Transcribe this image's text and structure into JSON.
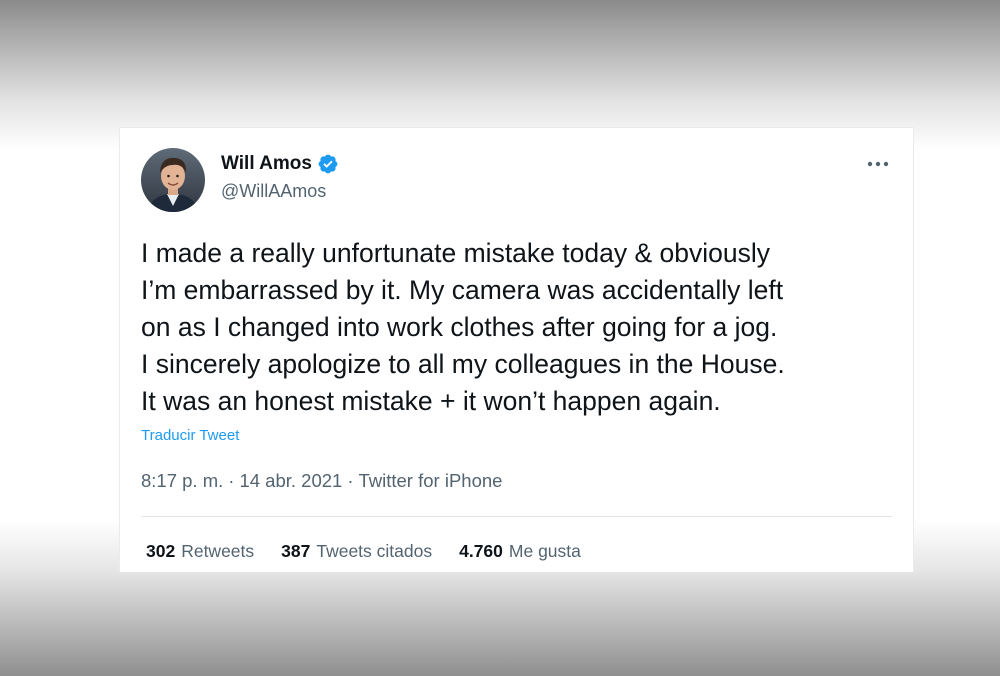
{
  "author": {
    "display_name": "Will Amos",
    "handle": "@WillAAmos",
    "verified": true,
    "verified_color": "#1d9bf0"
  },
  "tweet": {
    "text": "I made a really unfortunate mistake today & obviously\nI’m embarrassed by it. My camera was accidentally left\non as I changed into work clothes after going for a jog.\nI sincerely apologize to all my colleagues in the House.\nIt was an honest mistake + it won’t happen again.",
    "translate_label": "Traducir Tweet",
    "time": "8:17 p. m.",
    "separator": "·",
    "date": "14 abr. 2021",
    "source": "Twitter for iPhone"
  },
  "stats": [
    {
      "count": "302",
      "label": "Retweets"
    },
    {
      "count": "387",
      "label": "Tweets citados"
    },
    {
      "count": "4.760",
      "label": "Me gusta"
    }
  ],
  "icons": {
    "more": "more-horizontal-icon",
    "verified": "verified-badge-icon",
    "avatar": "profile-photo"
  },
  "colors": {
    "text_primary": "#0f1419",
    "text_secondary": "#536471",
    "link": "#1d9bf0"
  }
}
